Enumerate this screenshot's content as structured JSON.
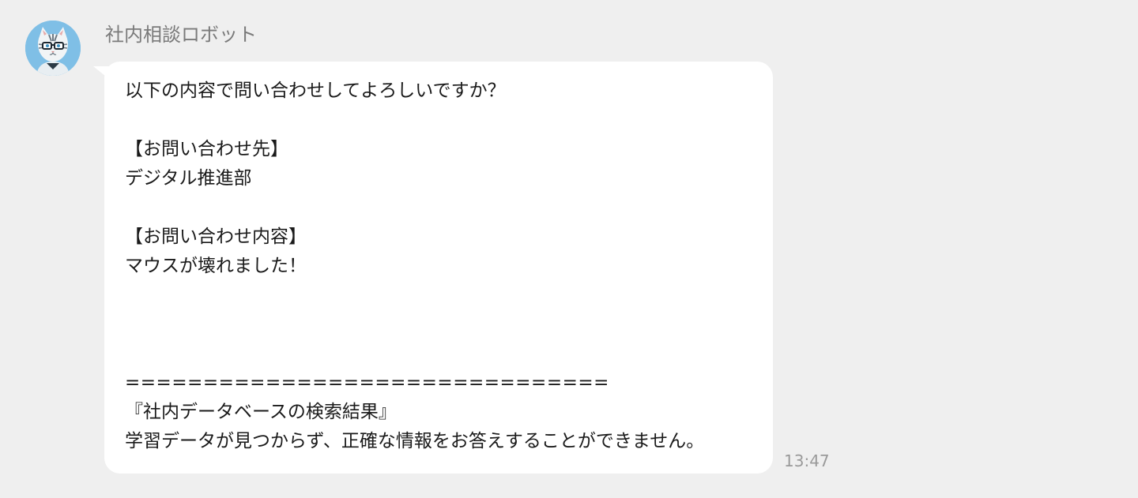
{
  "chat": {
    "sender": {
      "name": "社内相談ロボット",
      "avatar_icon": "robot-cat-avatar-icon"
    },
    "message": {
      "lines": [
        "以下の内容で問い合わせしてよろしいですか？",
        "",
        "【お問い合わせ先】",
        "デジタル推進部",
        "",
        "【お問い合わせ内容】",
        "マウスが壊れました！",
        "",
        "",
        "",
        "===============================",
        "『社内データベースの検索結果』",
        "学習データが見つからず、正確な情報をお答えすることができません。"
      ],
      "timestamp": "13:47"
    }
  },
  "colors": {
    "background": "#efefef",
    "bubble": "#ffffff",
    "sender_name": "#7a7a7a",
    "timestamp": "#9a9a9a",
    "avatar_bg": "#7fbfe6"
  }
}
